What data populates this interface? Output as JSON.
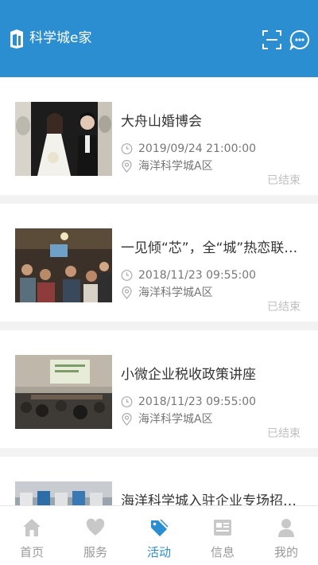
{
  "app": {
    "title": "科学城e家"
  },
  "events": [
    {
      "title": "大舟山婚博会",
      "time": "2019/09/24 21:00:00",
      "location": "海洋科学城A区",
      "status": "已结束",
      "image": "wedding-couple-photo"
    },
    {
      "title": "一见倾“芯”，全“城”热恋联谊会",
      "time": "2018/11/23 09:55:00",
      "location": "海洋科学城A区",
      "status": "已结束",
      "image": "social-gathering-photo"
    },
    {
      "title": "小微企业税收政策讲座",
      "time": "2018/11/23 09:55:00",
      "location": "海洋科学城A区",
      "status": "已结束",
      "image": "lecture-hall-photo"
    },
    {
      "title": "海洋科学城入驻企业专场招聘会",
      "image": "recruitment-fair-photo"
    }
  ],
  "tabbar": {
    "active": "活动",
    "tabs": [
      {
        "label": "首页",
        "icon": "home-icon"
      },
      {
        "label": "服务",
        "icon": "heart-icon"
      },
      {
        "label": "活动",
        "icon": "tag-icon"
      },
      {
        "label": "信息",
        "icon": "news-icon"
      },
      {
        "label": "我的",
        "icon": "person-icon"
      }
    ]
  },
  "colors": {
    "brand": "#2b8ed0",
    "title": "#333333",
    "meta": "#777777",
    "status": "#c0c0c0",
    "tab_inactive": "#999999"
  }
}
